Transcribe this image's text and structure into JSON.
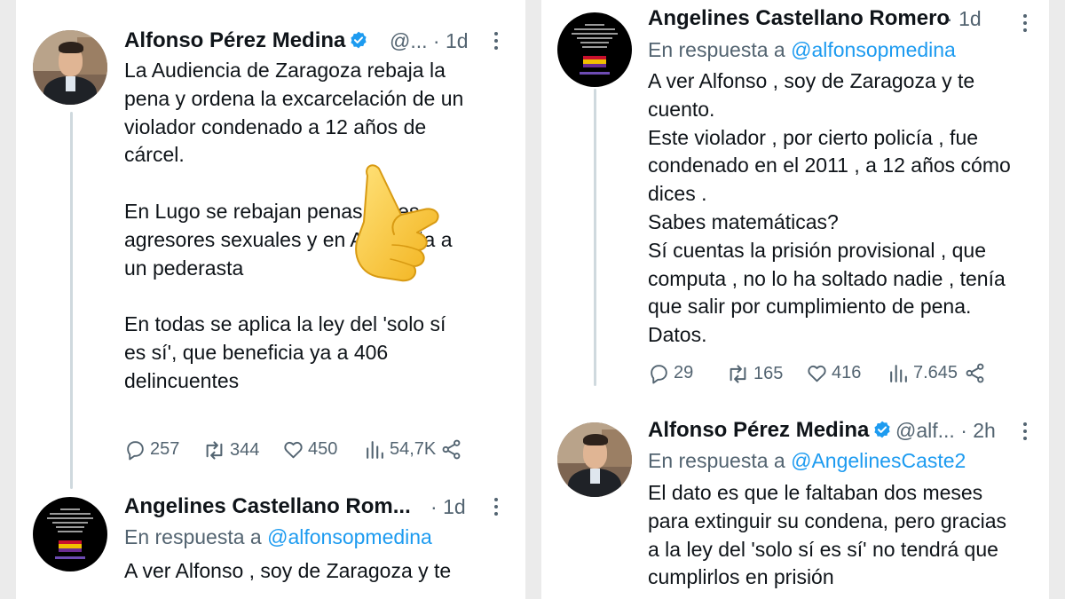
{
  "left": {
    "tweet1": {
      "name": "Alfonso Pérez Medina",
      "handle": "@...",
      "dot": "·",
      "time": "1d",
      "text": "La Audiencia de Zaragoza rebaja la\npena y ordena la excarcelación de un\nviolador condenado a 12 años de\ncárcel.\n\nEn Lugo se rebajan penas a tres\nagresores sexuales y en A Coruña a\nun pederasta\n\nEn todas se aplica la ley del 'solo sí\nes sí', que beneficia ya a 406\ndelincuentes",
      "replies": "257",
      "retweets": "344",
      "likes": "450",
      "views": "54,7K"
    },
    "tweet2": {
      "name": "Angelines Castellano Rom...",
      "dot": "·",
      "time": "1d",
      "reply_prefix": "En respuesta a",
      "reply_to": "@alfonsopmedina",
      "text": "A ver Alfonso , soy de Zaragoza y te"
    }
  },
  "right": {
    "tweet1": {
      "name": "Angelines Castellano Romero",
      "dot": "·",
      "time": "1d",
      "reply_prefix": "En respuesta a",
      "reply_to": "@alfonsopmedina",
      "text": "A ver Alfonso , soy de Zaragoza y te\ncuento.\nEste violador , por cierto policía , fue\ncondenado en el 2011 , a 12 años cómo\ndices .\nSabes matemáticas?\nSí cuentas la prisión provisional , que\ncomputa , no lo ha soltado nadie , tenía\nque salir por cumplimiento de pena.\nDatos.",
      "replies": "29",
      "retweets": "165",
      "likes": "416",
      "views": "7.645"
    },
    "tweet2": {
      "name": "Alfonso Pérez Medina",
      "handle": "@alf...",
      "dot": "·",
      "time": "2h",
      "reply_prefix": "En respuesta a",
      "reply_to": "@AngelinesCaste2",
      "text": "El dato es que le faltaban dos meses\npara extinguir su condena, pero gracias\na la ley del 'solo sí es sí' no tendrá que\ncumplirlos en prisión"
    }
  },
  "avatar_text": {
    "line1": "18 de Julio",
    "line2": "No fue una \"Guerra Civil\"",
    "line3": "fue un GOLPE DE ESTADO",
    "line4": "contra un régimen",
    "line5": "democrático,",
    "line6": "popular y laico.",
    "line7": "Viva la REPÚBLICA"
  },
  "colors": {
    "link": "#1d9bf0",
    "secondary": "#536471",
    "verified": "#1d9bf0",
    "thread": "#cfd9de"
  },
  "icons": [
    "reply-icon",
    "retweet-icon",
    "like-icon",
    "views-icon",
    "share-icon",
    "verified-icon",
    "more-icon",
    "pointing-hand-emoji"
  ]
}
